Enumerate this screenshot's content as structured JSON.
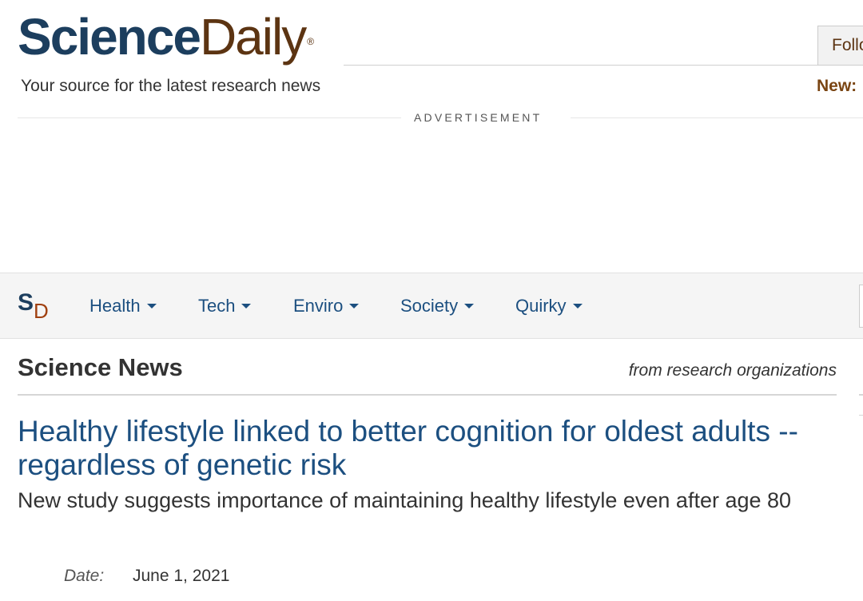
{
  "header": {
    "logo_science": "Science",
    "logo_daily": "Daily",
    "logo_reg": "®",
    "tagline": "Your source for the latest research news",
    "follow_label": "Follo",
    "new_label": "New:"
  },
  "ad": {
    "label": "ADVERTISEMENT"
  },
  "nav": {
    "logo_s": "S",
    "logo_d": "D",
    "items": [
      {
        "label": "Health"
      },
      {
        "label": "Tech"
      },
      {
        "label": "Enviro"
      },
      {
        "label": "Society"
      },
      {
        "label": "Quirky"
      }
    ]
  },
  "section": {
    "title": "Science News",
    "subtitle": "from research organizations"
  },
  "article": {
    "headline": "Healthy lifestyle linked to better cognition for oldest adults -- regardless of genetic risk",
    "subhead": "New study suggests importance of maintaining healthy lifestyle even after age 80",
    "date_label": "Date:",
    "date_value": "June 1, 2021"
  },
  "colors": {
    "brand_blue": "#1c3e5e",
    "brand_brown": "#5c3412",
    "link_blue": "#1c4f80",
    "nav_bg": "#f5f5f5"
  },
  "icons": {
    "nav_caret": "chevron-down-icon"
  }
}
